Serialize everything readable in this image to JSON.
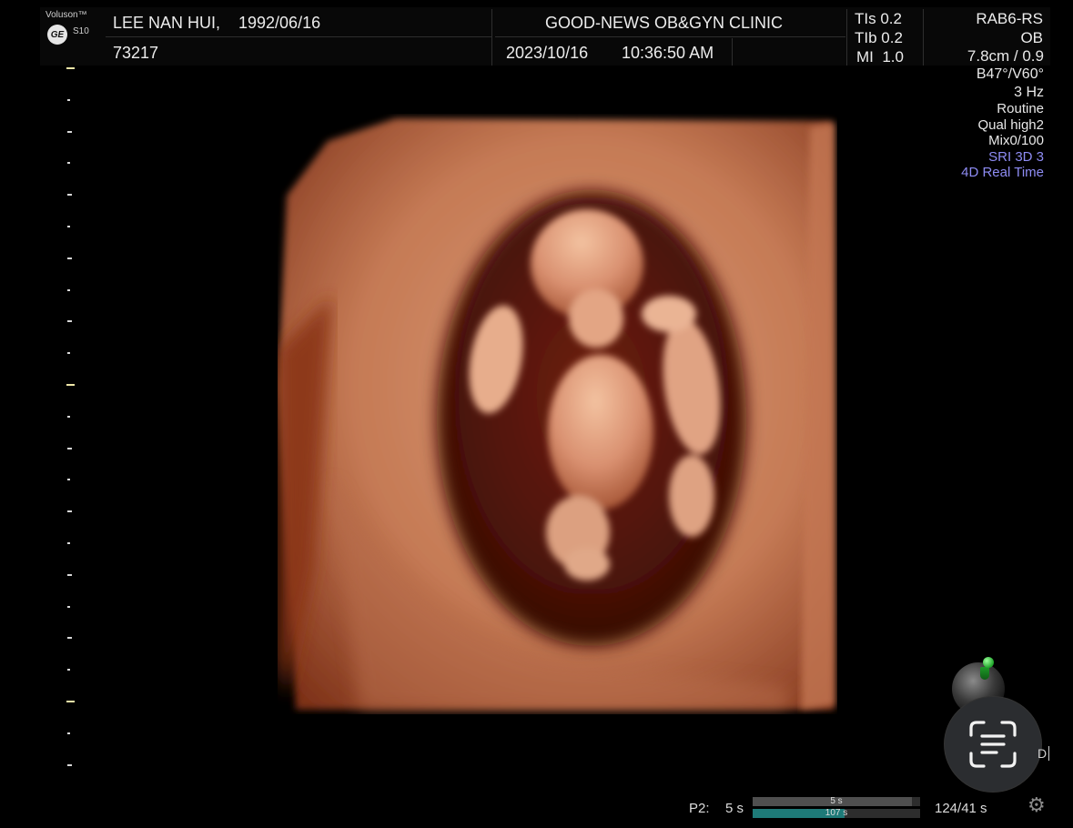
{
  "header": {
    "brand": "Voluson™",
    "logo": "GE",
    "model": "S10",
    "patient_name": "LEE NAN HUI,",
    "patient_dob": "1992/06/16",
    "patient_id": "73217",
    "clinic": "GOOD-NEWS OB&GYN CLINIC",
    "date": "2023/10/16",
    "time": "10:36:50 AM",
    "tis": "TIs 0.2",
    "tib": "TIb 0.2",
    "mi": "MI  1.0",
    "probe": "RAB6-RS",
    "preset": "OB"
  },
  "info": {
    "depth": "7.8cm / 0.9",
    "angle": "B47°/V60°",
    "rate": "3 Hz",
    "mode": "Routine",
    "quality": "Qual high2",
    "mix": "Mix0/100",
    "sri": "SRI 3D 3",
    "realtime": "4D Real Time"
  },
  "overlay": {
    "d_label": "D"
  },
  "footer": {
    "p2_label": "P2:",
    "p2_value": "5 s",
    "bar1_label": "5 s",
    "bar2_label": "107 s",
    "bar1_fill": 0.95,
    "bar2_fill": 0.55,
    "frames": "124/41 s"
  },
  "colors": {
    "violet": "#8e8cf4",
    "bar1": "#4f4f4f",
    "bar2": "#1e7a78",
    "render_skin": "#c98460",
    "render_dark": "#3a0d06"
  },
  "icons": {
    "logo": "ge-logo-icon",
    "scan": "text-scan-icon",
    "settings": "gear-icon",
    "orientation": "orientation-sphere-icon"
  }
}
